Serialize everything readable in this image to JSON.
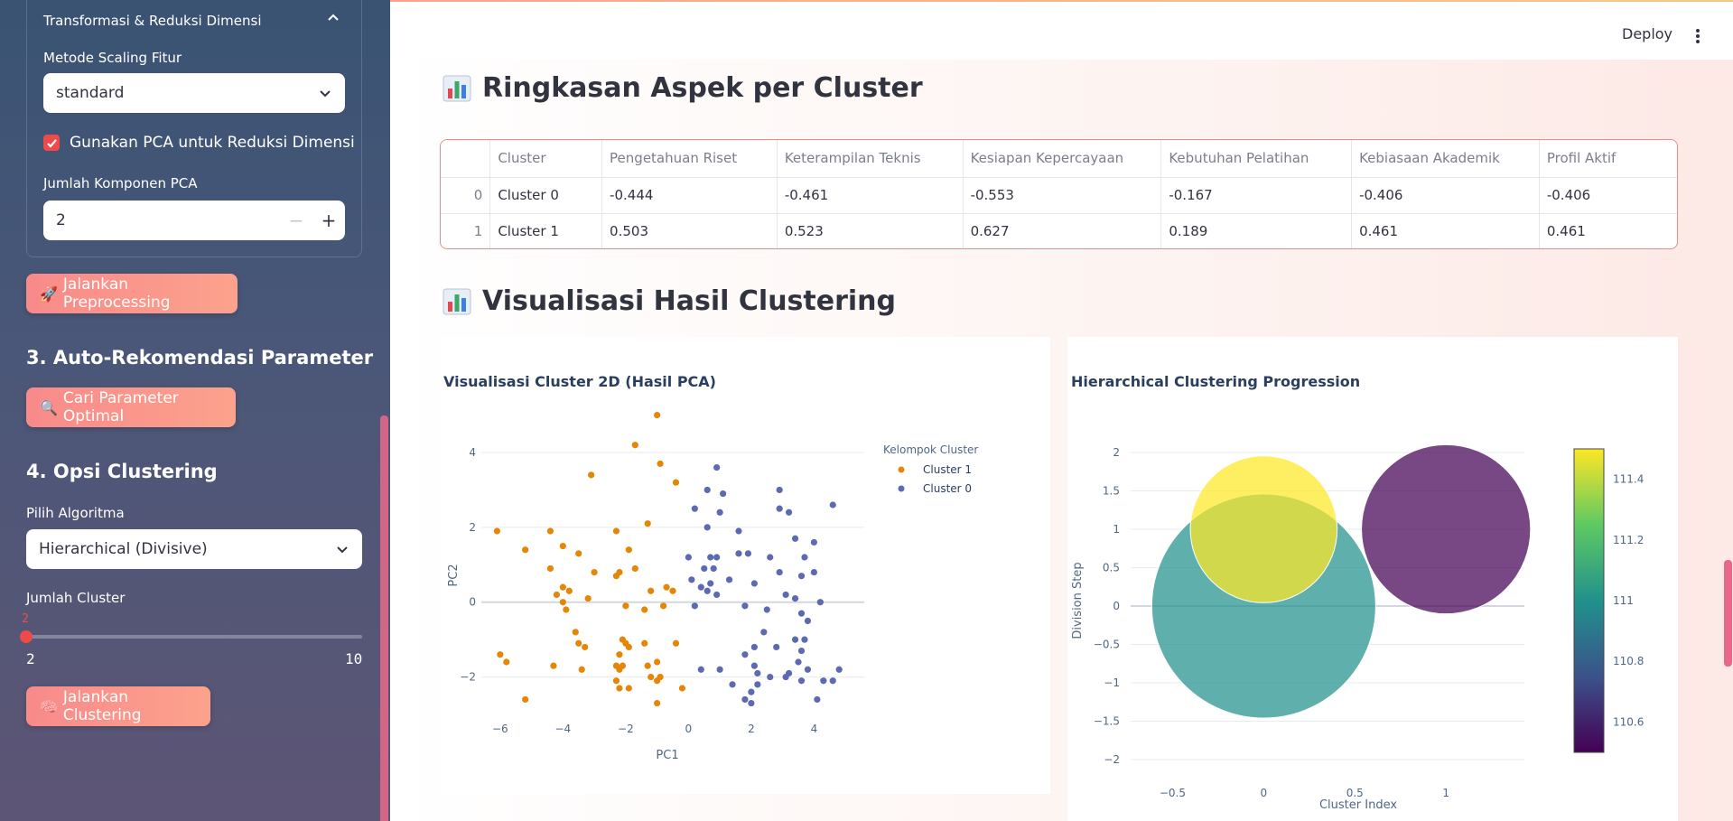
{
  "sidebar": {
    "expander_title": "Transformasi & Reduksi Dimensi",
    "scaling_label": "Metode Scaling Fitur",
    "scaling_value": "standard",
    "pca_checkbox_label": "Gunakan PCA untuk Reduksi Dimensi",
    "pca_checked": true,
    "pca_components_label": "Jumlah Komponen PCA",
    "pca_components_value": "2",
    "preprocess_button": "Jalankan Preprocessing",
    "preprocess_icon": "🚀",
    "section3_title": "3. Auto-Rekomendasi Parameter",
    "optimal_button": "Cari Parameter Optimal",
    "optimal_icon": "🔍",
    "section4_title": "4. Opsi Clustering",
    "algo_label": "Pilih Algoritma",
    "algo_value": "Hierarchical (Divisive)",
    "cluster_count_label": "Jumlah Cluster",
    "slider_value": "2",
    "slider_min": "2",
    "slider_max": "10",
    "cluster_button": "Jalankan Clustering",
    "cluster_icon": "🧠"
  },
  "header": {
    "deploy_label": "Deploy"
  },
  "summary": {
    "title": "Ringkasan Aspek per Cluster",
    "columns": [
      "",
      "Cluster",
      "Pengetahuan Riset",
      "Keterampilan Teknis",
      "Kesiapan Kepercayaan",
      "Kebutuhan Pelatihan",
      "Kebiasaan Akademik",
      "Profil Aktif"
    ],
    "rows": [
      [
        "0",
        "Cluster 0",
        "-0.444",
        "-0.461",
        "-0.553",
        "-0.167",
        "-0.406",
        "-0.406"
      ],
      [
        "1",
        "Cluster 1",
        "0.503",
        "0.523",
        "0.627",
        "0.189",
        "0.461",
        "0.461"
      ]
    ]
  },
  "viz": {
    "title": "Visualisasi Hasil Clustering"
  },
  "chart_data": [
    {
      "type": "scatter",
      "title": "Visualisasi Cluster 2D (Hasil PCA)",
      "xlabel": "PC1",
      "ylabel": "PC2",
      "xlim": [
        -6.6,
        5.6
      ],
      "ylim": [
        -3.0,
        5.4
      ],
      "xticks": [
        -6,
        -4,
        -2,
        0,
        2,
        4
      ],
      "yticks": [
        -2,
        0,
        2,
        4
      ],
      "legend_title": "Kelompok Cluster",
      "legend_position": "top-right",
      "series": [
        {
          "name": "Cluster 1",
          "color": "#e58606",
          "points": [
            [
              -1.0,
              5.0
            ],
            [
              -1.7,
              4.2
            ],
            [
              -0.9,
              3.7
            ],
            [
              -3.1,
              3.4
            ],
            [
              -0.4,
              3.2
            ],
            [
              -6.1,
              1.9
            ],
            [
              -4.4,
              1.9
            ],
            [
              -1.3,
              2.1
            ],
            [
              -2.3,
              1.9
            ],
            [
              -5.2,
              1.4
            ],
            [
              -4.0,
              1.5
            ],
            [
              -3.5,
              1.3
            ],
            [
              -1.9,
              1.4
            ],
            [
              -4.4,
              0.9
            ],
            [
              -3.0,
              0.8
            ],
            [
              -2.2,
              0.8
            ],
            [
              -1.7,
              0.9
            ],
            [
              -2.3,
              0.7
            ],
            [
              -4.0,
              0.4
            ],
            [
              -4.2,
              0.2
            ],
            [
              -3.8,
              0.3
            ],
            [
              -4.0,
              0.0
            ],
            [
              -3.9,
              -0.2
            ],
            [
              -3.2,
              0.1
            ],
            [
              -2.0,
              -0.1
            ],
            [
              -1.4,
              -0.2
            ],
            [
              -0.8,
              -0.1
            ],
            [
              -1.2,
              0.3
            ],
            [
              -0.7,
              0.4
            ],
            [
              -0.5,
              0.3
            ],
            [
              -3.6,
              -0.8
            ],
            [
              -3.5,
              -1.1
            ],
            [
              -3.3,
              -1.2
            ],
            [
              -2.1,
              -1.0
            ],
            [
              -0.4,
              -1.1
            ],
            [
              -6.0,
              -1.4
            ],
            [
              -5.8,
              -1.6
            ],
            [
              -4.3,
              -1.7
            ],
            [
              -3.4,
              -1.8
            ],
            [
              -2.2,
              -1.4
            ],
            [
              -1.9,
              -1.2
            ],
            [
              -2.0,
              -1.1
            ],
            [
              -1.4,
              -1.1
            ],
            [
              -2.3,
              -1.7
            ],
            [
              -2.2,
              -1.8
            ],
            [
              -2.1,
              -1.7
            ],
            [
              -1.3,
              -1.7
            ],
            [
              -1.0,
              -1.6
            ],
            [
              -0.9,
              -2.0
            ],
            [
              -1.2,
              -2.0
            ],
            [
              -1.0,
              -2.1
            ],
            [
              -2.3,
              -2.1
            ],
            [
              -2.2,
              -2.3
            ],
            [
              -1.9,
              -2.3
            ],
            [
              -0.2,
              -2.3
            ],
            [
              -5.2,
              -2.6
            ],
            [
              -1.0,
              -2.7
            ]
          ]
        },
        {
          "name": "Cluster 0",
          "color": "#5d69b1",
          "points": [
            [
              0.9,
              3.6
            ],
            [
              0.6,
              3.0
            ],
            [
              1.1,
              2.9
            ],
            [
              2.9,
              3.0
            ],
            [
              4.6,
              2.6
            ],
            [
              0.2,
              2.5
            ],
            [
              1.0,
              2.4
            ],
            [
              2.9,
              2.5
            ],
            [
              3.2,
              2.4
            ],
            [
              0.6,
              2.0
            ],
            [
              1.6,
              1.9
            ],
            [
              3.4,
              1.7
            ],
            [
              4.0,
              1.6
            ],
            [
              0.0,
              1.2
            ],
            [
              0.7,
              1.2
            ],
            [
              0.9,
              1.2
            ],
            [
              1.6,
              1.3
            ],
            [
              1.9,
              1.3
            ],
            [
              2.6,
              1.2
            ],
            [
              3.7,
              1.2
            ],
            [
              0.5,
              0.9
            ],
            [
              0.8,
              0.9
            ],
            [
              0.1,
              0.6
            ],
            [
              1.3,
              0.6
            ],
            [
              2.1,
              0.5
            ],
            [
              2.9,
              0.8
            ],
            [
              3.6,
              0.7
            ],
            [
              4.0,
              0.8
            ],
            [
              0.4,
              0.4
            ],
            [
              0.6,
              0.3
            ],
            [
              0.7,
              0.5
            ],
            [
              0.9,
              0.2
            ],
            [
              3.1,
              0.2
            ],
            [
              3.4,
              0.1
            ],
            [
              4.2,
              0.0
            ],
            [
              0.2,
              -0.1
            ],
            [
              1.8,
              -0.1
            ],
            [
              2.5,
              -0.2
            ],
            [
              3.6,
              -0.3
            ],
            [
              3.8,
              -0.5
            ],
            [
              2.4,
              -0.8
            ],
            [
              3.4,
              -1.0
            ],
            [
              3.7,
              -1.0
            ],
            [
              2.8,
              -1.2
            ],
            [
              3.6,
              -1.3
            ],
            [
              2.1,
              -1.2
            ],
            [
              3.5,
              -1.6
            ],
            [
              1.8,
              -1.4
            ],
            [
              0.4,
              -1.8
            ],
            [
              1.0,
              -1.8
            ],
            [
              2.1,
              -1.7
            ],
            [
              2.2,
              -1.9
            ],
            [
              2.6,
              -2.0
            ],
            [
              3.1,
              -2.0
            ],
            [
              3.2,
              -1.9
            ],
            [
              3.8,
              -1.8
            ],
            [
              4.3,
              -2.1
            ],
            [
              4.6,
              -2.1
            ],
            [
              4.8,
              -1.8
            ],
            [
              1.4,
              -2.2
            ],
            [
              2.2,
              -2.2
            ],
            [
              3.6,
              -2.1
            ],
            [
              2.0,
              -2.4
            ],
            [
              1.8,
              -2.6
            ],
            [
              2.0,
              -2.7
            ],
            [
              4.1,
              -2.6
            ]
          ]
        }
      ]
    },
    {
      "type": "scatter",
      "title": "Hierarchical Clustering Progression",
      "xlabel": "Cluster Index",
      "ylabel": "Division Step",
      "xlim": [
        -0.73,
        1.43
      ],
      "ylim": [
        -2.0,
        2.0
      ],
      "xticks": [
        -0.5,
        0,
        0.5,
        1
      ],
      "yticks": [
        -2,
        -1.5,
        -1,
        -0.5,
        0,
        0.5,
        1,
        1.5,
        2
      ],
      "colorbar_ticks": [
        110.6,
        110.8,
        111,
        111.2,
        111.4
      ],
      "colorbar_range": [
        110.5,
        111.5
      ],
      "bubbles": [
        {
          "x": 0,
          "y": 0,
          "size": 100,
          "color_value": 111.0
        },
        {
          "x": 0,
          "y": 1,
          "size": 43,
          "color_value": 111.5
        },
        {
          "x": 1,
          "y": 1,
          "size": 57,
          "color_value": 110.5
        }
      ]
    }
  ]
}
